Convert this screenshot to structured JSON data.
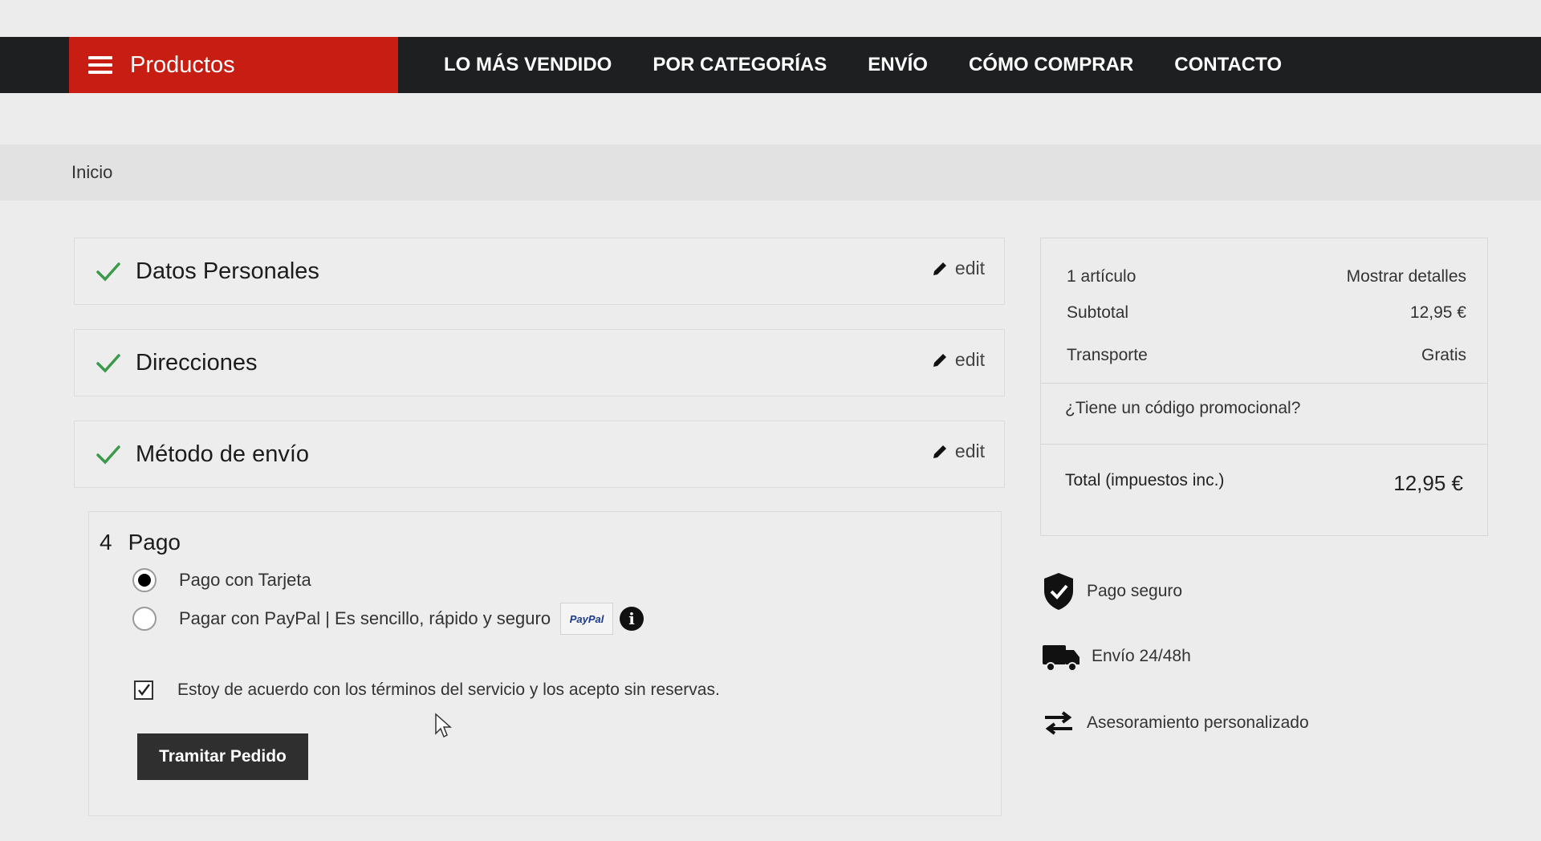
{
  "nav": {
    "products_label": "Productos",
    "items": [
      "LO MÁS VENDIDO",
      "POR CATEGORÍAS",
      "ENVÍO",
      "CÓMO COMPRAR",
      "CONTACTO"
    ]
  },
  "breadcrumb": "Inicio",
  "steps": [
    {
      "title": "Datos Personales",
      "edit_label": "edit"
    },
    {
      "title": "Direcciones",
      "edit_label": "edit"
    },
    {
      "title": "Método de envío",
      "edit_label": "edit"
    }
  ],
  "payment": {
    "number": "4",
    "title": "Pago",
    "options": [
      {
        "label": "Pago con Tarjeta",
        "selected": true
      },
      {
        "label": "Pagar con PayPal | Es sencillo, rápido y seguro",
        "selected": false
      }
    ],
    "paypal_logo": "PayPal",
    "info_glyph": "i",
    "terms": "Estoy de acuerdo con los términos del servicio y los acepto sin reservas.",
    "terms_checked": true,
    "submit_label": "Tramitar Pedido"
  },
  "summary": {
    "items_count": "1 artículo",
    "show_details": "Mostrar detalles",
    "subtotal_label": "Subtotal",
    "subtotal_value": "12,95 €",
    "shipping_label": "Transporte",
    "shipping_value": "Gratis",
    "promo_label": "¿Tiene un código promocional?",
    "total_label": "Total (impuestos inc.)",
    "total_value": "12,95 €"
  },
  "reassurance": [
    {
      "icon": "shield-check-icon",
      "label": "Pago seguro"
    },
    {
      "icon": "truck-icon",
      "label": "Envío 24/48h"
    },
    {
      "icon": "swap-arrows-icon",
      "label": "Asesoramiento personalizado"
    }
  ],
  "colors": {
    "nav_bg": "#1e1f20",
    "brand_red": "#c81d12",
    "check_green": "#3a9a4a",
    "button_dark": "#2f2f2f"
  }
}
